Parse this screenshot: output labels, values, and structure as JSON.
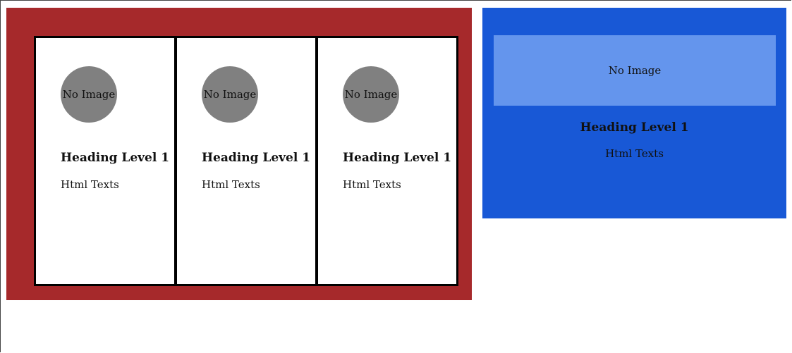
{
  "colors": {
    "left_panel": "#a6292b",
    "right_panel": "#1858d6",
    "image_placeholder_circle": "#808080",
    "image_placeholder_banner": "#6495ed"
  },
  "cards": [
    {
      "image_text": "No Image",
      "heading": "Heading Level 1",
      "text": "Html Texts"
    },
    {
      "image_text": "No Image",
      "heading": "Heading Level 1",
      "text": "Html Texts"
    },
    {
      "image_text": "No Image",
      "heading": "Heading Level 1",
      "text": "Html Texts"
    }
  ],
  "feature": {
    "image_text": "No Image",
    "heading": "Heading Level 1",
    "text": "Html Texts"
  }
}
